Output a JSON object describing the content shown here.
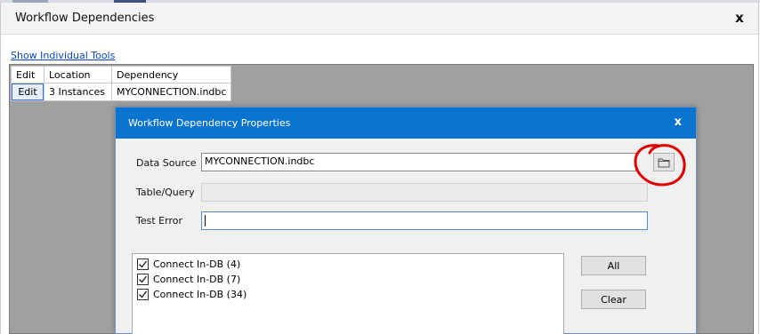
{
  "window": {
    "title": "Workflow Dependencies",
    "close_label": "x"
  },
  "link": {
    "show_tools": "Show Individual Tools"
  },
  "table": {
    "headers": [
      "Edit",
      "Location",
      "Dependency"
    ],
    "rows": [
      {
        "edit": "Edit",
        "location": "3 Instances",
        "dependency": "MYCONNECTION.indbc"
      }
    ]
  },
  "dialog": {
    "title": "Workflow Dependency Properties",
    "close_label": "x",
    "fields": {
      "data_source_label": "Data Source",
      "data_source_value": "MYCONNECTION.indbc",
      "table_query_label": "Table/Query",
      "table_query_value": "",
      "test_error_label": "Test Error",
      "test_error_value": ""
    },
    "tools": [
      {
        "label": "Connect In-DB (4)",
        "checked": true
      },
      {
        "label": "Connect In-DB (7)",
        "checked": true
      },
      {
        "label": "Connect In-DB (34)",
        "checked": true
      }
    ],
    "buttons": {
      "all": "All",
      "clear": "Clear"
    }
  },
  "icons": {
    "browse": "folder-icon",
    "highlight": "red-circle-annotation"
  },
  "colors": {
    "dialog_titlebar": "#0b74cf",
    "link": "#0b45c4",
    "annotation": "#e00000"
  }
}
